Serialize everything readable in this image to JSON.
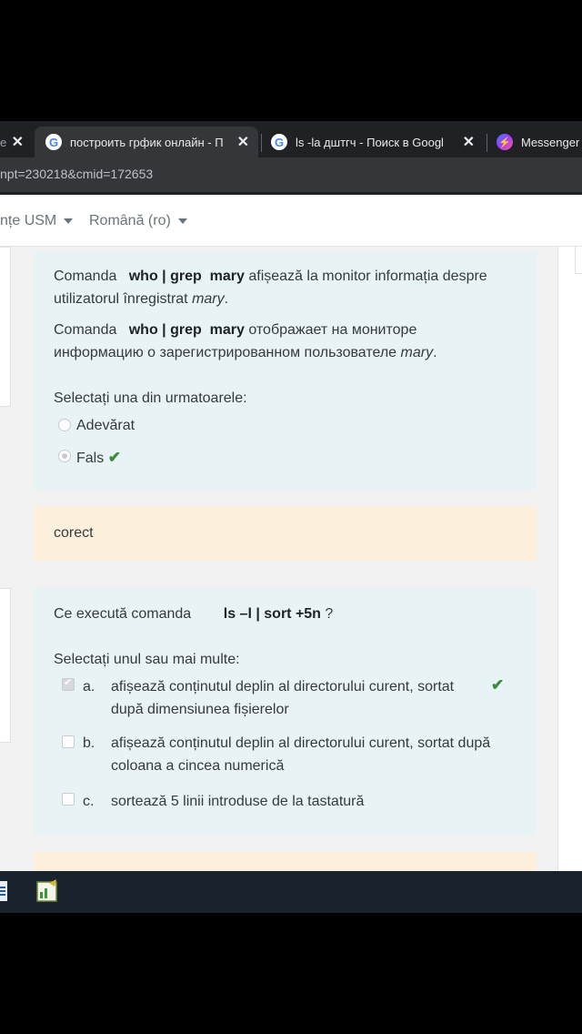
{
  "browser": {
    "tabs": [
      {
        "title": "e",
        "close": "✕"
      },
      {
        "title": "построить грфик онлайн - П",
        "close": "✕"
      },
      {
        "title": "ls -la дштгч - Поиск в Googl",
        "close": "✕"
      },
      {
        "title": "Messenger",
        "close": ""
      }
    ],
    "url": "npt=230218&cmid=172653"
  },
  "header": {
    "site_link": "nțe USM",
    "language": "Română (ro)"
  },
  "question1": {
    "line1_pre": "Comanda",
    "line1_bold": "who | grep  mary",
    "line1_post": "afișează la monitor informația despre",
    "line2_pre": "utilizatorul înregistrat",
    "line2_em": "mary",
    "line2_end": ".",
    "line3_pre": "Comanda",
    "line3_bold": "who | grep  mary",
    "line3_post": "отображает на мониторе",
    "line4_pre": "информацию о зарегистрированном пользователе",
    "line4_em": "mary",
    "line4_end": ".",
    "prompt": "Selectați una din urmatoarele:",
    "options": [
      "Adevărat",
      "Fals"
    ],
    "feedback": "corect"
  },
  "question2": {
    "text_pre": "Ce execută comanda",
    "text_bold": "ls –l | sort +5n",
    "text_post": "?",
    "prompt": "Selectați unul sau mai multe:",
    "options": [
      {
        "letter": "a.",
        "line1": "afișează conținutul deplin al directorului curent, sortat",
        "line2": "după dimensiunea fișierelor"
      },
      {
        "letter": "b.",
        "line1": "afișează conținutul deplin al directorului curent, sortat după",
        "line2": "coloana a cincea numerică"
      },
      {
        "letter": "c.",
        "line1": "sortează 5 linii introduse de la tastatură",
        "line2": ""
      }
    ]
  },
  "icons": {
    "check": "✔"
  }
}
